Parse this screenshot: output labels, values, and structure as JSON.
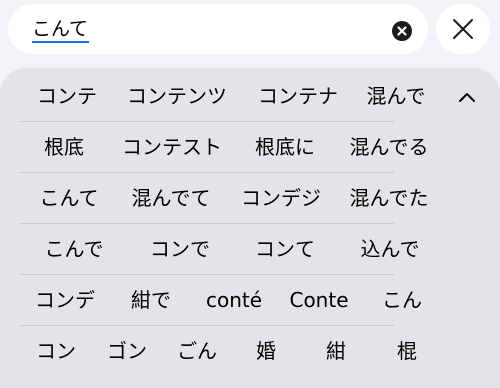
{
  "search": {
    "value": "こんて",
    "clear_icon": "clear-circle-icon",
    "close_icon": "close-x-icon"
  },
  "candidates": {
    "collapse_icon": "chevron-up-icon",
    "rows": [
      [
        "コンテ",
        "コンテンツ",
        "コンテナ",
        "混んで"
      ],
      [
        "根底",
        "コンテスト",
        "根底に",
        "混んでる"
      ],
      [
        "こんて",
        "混んでて",
        "コンデジ",
        "混んでた"
      ],
      [
        "こんで",
        "コンで",
        "コンて",
        "込んで"
      ],
      [
        "コンデ",
        "紺で",
        "conté",
        "Conte",
        "こん"
      ],
      [
        "コン",
        "ゴン",
        "ごん",
        "婚",
        "紺",
        "棍"
      ]
    ]
  }
}
